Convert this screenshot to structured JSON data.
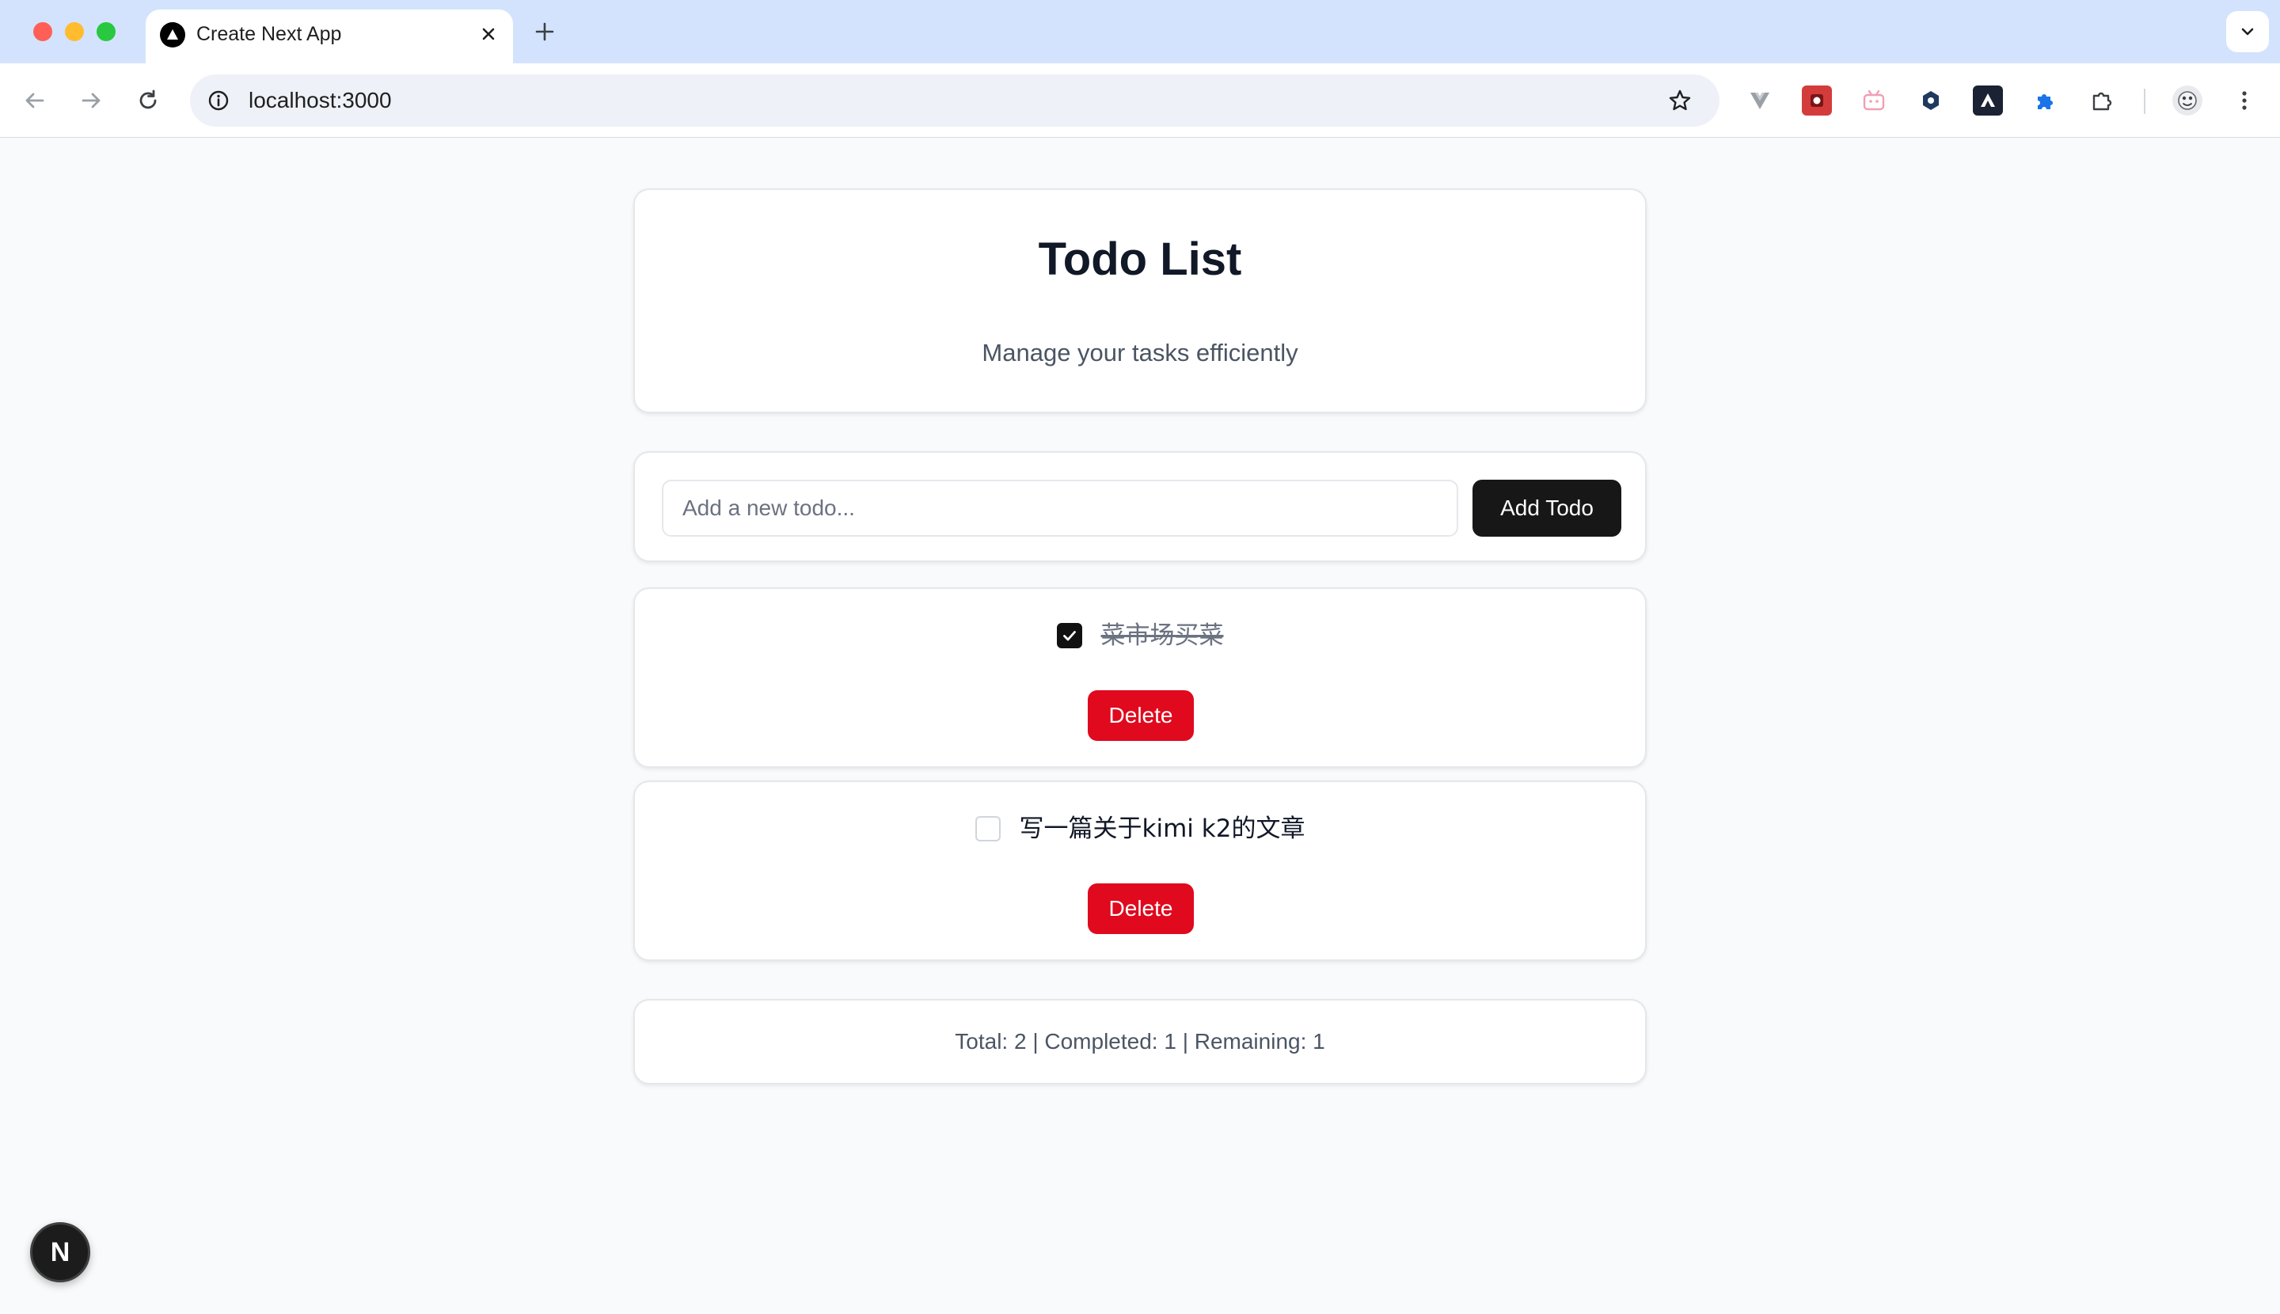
{
  "browser": {
    "tab_title": "Create Next App",
    "url": "localhost:3000",
    "colors": {
      "tabbar": "#d3e3fd",
      "toolbar": "#ffffff",
      "omnibox": "#eef1f7"
    },
    "icons": [
      "back-arrow-icon",
      "forward-arrow-icon",
      "reload-icon",
      "site-info-icon",
      "bookmark-star-icon",
      "puzzle-extensions-icon",
      "kebab-menu-icon"
    ]
  },
  "header": {
    "title": "Todo List",
    "subtitle": "Manage your tasks efficiently"
  },
  "form": {
    "placeholder": "Add a new todo...",
    "value": "",
    "add_label": "Add Todo"
  },
  "todos": [
    {
      "text": "菜市场买菜",
      "completed": true,
      "delete_label": "Delete"
    },
    {
      "text": "写一篇关于kimi k2的文章",
      "completed": false,
      "delete_label": "Delete"
    }
  ],
  "stats": {
    "text": "Total: 2 | Completed: 1 | Remaining: 1"
  },
  "dev_badge": {
    "label": "N"
  },
  "colors": {
    "page_bg": "#f9fafb",
    "primary_button": "#171717",
    "delete_button": "#e0091e",
    "title_text": "#111827",
    "muted_text": "#4b5563"
  }
}
